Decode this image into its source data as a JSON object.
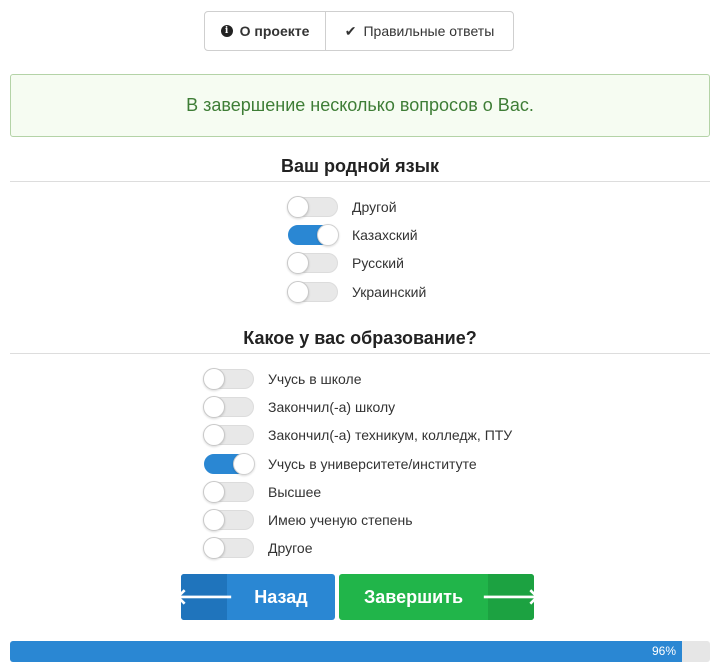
{
  "header": {
    "about_label": "О проекте",
    "answers_label": "Правильные ответы"
  },
  "notice": {
    "text": "В завершение несколько вопросов о Вас."
  },
  "questions": [
    {
      "title": "Ваш родной язык",
      "options": [
        {
          "label": "Другой",
          "selected": false
        },
        {
          "label": "Казахский",
          "selected": true
        },
        {
          "label": "Русский",
          "selected": false
        },
        {
          "label": "Украинский",
          "selected": false
        }
      ]
    },
    {
      "title": "Какое у вас образование?",
      "options": [
        {
          "label": "Учусь в школе",
          "selected": false
        },
        {
          "label": "Закончил(-а) школу",
          "selected": false
        },
        {
          "label": "Закончил(-а) техникум, колледж, ПТУ",
          "selected": false
        },
        {
          "label": "Учусь в университете/институте",
          "selected": true
        },
        {
          "label": "Высшее",
          "selected": false
        },
        {
          "label": "Имею ученую степень",
          "selected": false
        },
        {
          "label": "Другое",
          "selected": false
        }
      ]
    }
  ],
  "nav": {
    "back_label": "Назад",
    "finish_label": "Завершить"
  },
  "progress": {
    "value": 0.96,
    "text": "96%"
  },
  "colors": {
    "accent_blue": "#2a87d3",
    "accent_green": "#21b54a",
    "notice_text": "#3e7d36"
  }
}
